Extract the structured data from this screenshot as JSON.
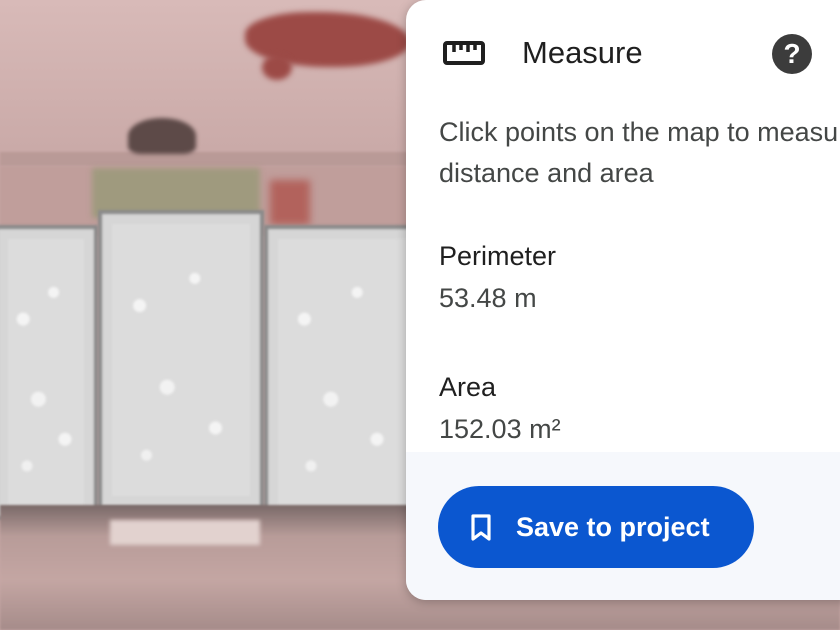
{
  "panel": {
    "title": "Measure",
    "title_icon": "ruler-icon",
    "help_icon": "help-icon",
    "help_glyph": "?",
    "instructions": "Click points on the map to measure distance and area",
    "perimeter": {
      "label": "Perimeter",
      "value": "53.48 m"
    },
    "area": {
      "label": "Area",
      "value": "152.03 m²"
    },
    "save_button": {
      "label": "Save to project",
      "icon": "bookmark-icon"
    }
  },
  "colors": {
    "accent": "#0b57d0",
    "panel_bg": "#ffffff",
    "footer_bg": "#f6f8fc"
  }
}
